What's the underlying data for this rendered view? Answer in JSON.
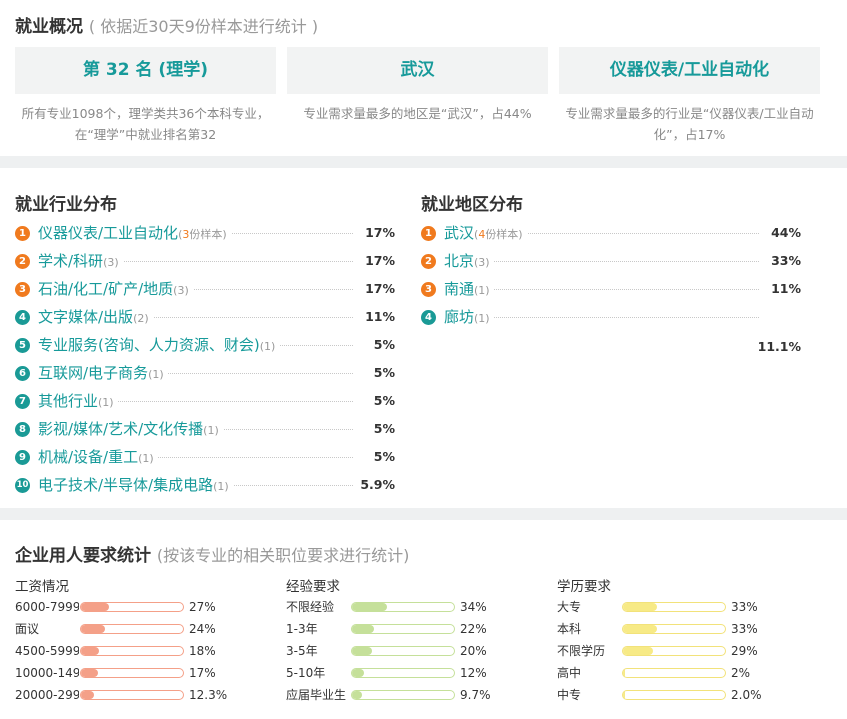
{
  "overview": {
    "title": "就业概况",
    "subtitle": "( 依据近30天9份样本进行统计 )",
    "boxes": [
      {
        "label": "第 32 名 (理学)",
        "desc": "所有专业1098个，理学类共36个本科专业，在“理学”中就业排名第32"
      },
      {
        "label": "武汉",
        "desc": "专业需求量最多的地区是“武汉”，占44%"
      },
      {
        "label": "仪器仪表/工业自动化",
        "desc": "专业需求量最多的行业是“仪器仪表/工业自动化”，占17%"
      }
    ]
  },
  "industry": {
    "title": "就业行业分布",
    "items": [
      {
        "rank": "1",
        "name": "仪器仪表/工业自动化",
        "count": "3份样本",
        "count_fmt": "full",
        "pct": "17%",
        "color": "orange"
      },
      {
        "rank": "2",
        "name": "学术/科研",
        "count": "(3)",
        "count_fmt": "short",
        "pct": "17%",
        "color": "orange"
      },
      {
        "rank": "3",
        "name": "石油/化工/矿产/地质",
        "count": "(3)",
        "count_fmt": "short",
        "pct": "17%",
        "color": "orange"
      },
      {
        "rank": "4",
        "name": "文字媒体/出版",
        "count": "(2)",
        "count_fmt": "short",
        "pct": "11%",
        "color": "teal"
      },
      {
        "rank": "5",
        "name": "专业服务(咨询、人力资源、财会)",
        "count": "(1)",
        "count_fmt": "short",
        "pct": "5%",
        "color": "teal"
      },
      {
        "rank": "6",
        "name": "互联网/电子商务",
        "count": "(1)",
        "count_fmt": "short",
        "pct": "5%",
        "color": "teal"
      },
      {
        "rank": "7",
        "name": "其他行业",
        "count": "(1)",
        "count_fmt": "short",
        "pct": "5%",
        "color": "teal"
      },
      {
        "rank": "8",
        "name": "影视/媒体/艺术/文化传播",
        "count": "(1)",
        "count_fmt": "short",
        "pct": "5%",
        "color": "teal"
      },
      {
        "rank": "9",
        "name": "机械/设备/重工",
        "count": "(1)",
        "count_fmt": "short",
        "pct": "5%",
        "color": "teal"
      },
      {
        "rank": "10",
        "name": "电子技术/半导体/集成电路",
        "count": "(1)",
        "count_fmt": "short",
        "pct": "5.9%",
        "color": "teal"
      }
    ]
  },
  "region": {
    "title": "就业地区分布",
    "items": [
      {
        "rank": "1",
        "name": "武汉",
        "count": "4份样本",
        "count_fmt": "full",
        "pct": "44%",
        "color": "orange"
      },
      {
        "rank": "2",
        "name": "北京",
        "count": "(3)",
        "count_fmt": "short",
        "pct": "33%",
        "color": "orange"
      },
      {
        "rank": "3",
        "name": "南通",
        "count": "(1)",
        "count_fmt": "short",
        "pct": "11%",
        "color": "orange"
      },
      {
        "rank": "4",
        "name": "廊坊",
        "count": "(1)",
        "count_fmt": "short",
        "pct": "",
        "color": "teal"
      }
    ],
    "extra_pct": "11.1%"
  },
  "requirements": {
    "title": "企业用人要求统计",
    "subtitle": "(按该专业的相关职位要求进行统计)",
    "columns": [
      {
        "title": "工资情况",
        "bar_color": "#f4a088",
        "border_color": "#f4a088",
        "rows": [
          {
            "label": "6000-7999",
            "value": "27%",
            "fill": 0.27
          },
          {
            "label": "面议",
            "value": "24%",
            "fill": 0.24
          },
          {
            "label": "4500-5999",
            "value": "18%",
            "fill": 0.18
          },
          {
            "label": "10000-14999",
            "value": "17%",
            "fill": 0.17
          },
          {
            "label": "20000-29999",
            "value": "12.3%",
            "fill": 0.123
          }
        ]
      },
      {
        "title": "经验要求",
        "bar_color": "#c5e09a",
        "border_color": "#c5e09a",
        "rows": [
          {
            "label": "不限经验",
            "value": "34%",
            "fill": 0.34
          },
          {
            "label": "1-3年",
            "value": "22%",
            "fill": 0.22
          },
          {
            "label": "3-5年",
            "value": "20%",
            "fill": 0.2
          },
          {
            "label": "5-10年",
            "value": "12%",
            "fill": 0.12
          },
          {
            "label": "应届毕业生",
            "value": "9.7%",
            "fill": 0.097
          }
        ]
      },
      {
        "title": "学历要求",
        "bar_color": "#f7ea86",
        "border_color": "#f2e27a",
        "rows": [
          {
            "label": "大专",
            "value": "33%",
            "fill": 0.33
          },
          {
            "label": "本科",
            "value": "33%",
            "fill": 0.33
          },
          {
            "label": "不限学历",
            "value": "29%",
            "fill": 0.29
          },
          {
            "label": "高中",
            "value": "2%",
            "fill": 0.02
          },
          {
            "label": "中专",
            "value": "2.0%",
            "fill": 0.02
          }
        ]
      }
    ]
  }
}
